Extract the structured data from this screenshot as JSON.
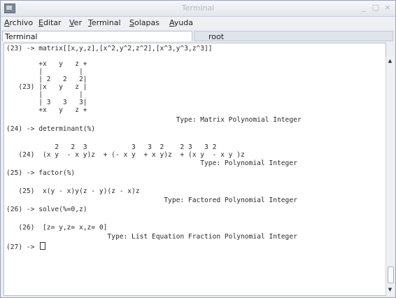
{
  "window": {
    "title": "Terminal"
  },
  "menu": [
    "Archivo",
    "Editar",
    "Ver",
    "Terminal",
    "Solapas",
    "Ayuda"
  ],
  "tabs": [
    "Terminal",
    "root"
  ],
  "lines": [
    "(23) -> matrix[[x,y,z],[x^2,y^2,z^2],[x^3,y^3,z^3]]",
    "",
    "        +x   y   z +",
    "        |         |",
    "        | 2   2   2|",
    "   (23) |x   y   z |",
    "        |         |",
    "        | 3   3   3|",
    "        +x   y   z +",
    "                                          Type: Matrix Polynomial Integer",
    "(24) -> determinant(%)",
    "",
    "            2   2  3           3   3  2    2 3   3 2",
    "   (24)  (x y  - x y)z  + (- x y  + x y)z  + (x y  - x y )z",
    "                                                Type: Polynomial Integer",
    "(25) -> factor(%)",
    "",
    "   (25)  x(y - x)y(z - y)(z - x)z",
    "                                       Type: Factored Polynomial Integer",
    "(26) -> solve(%=0,z)",
    "",
    "   (26)  [z= y,z= x,z= 0]",
    "                         Type: List Equation Fraction Polynomial Integer",
    "(27) -> "
  ]
}
